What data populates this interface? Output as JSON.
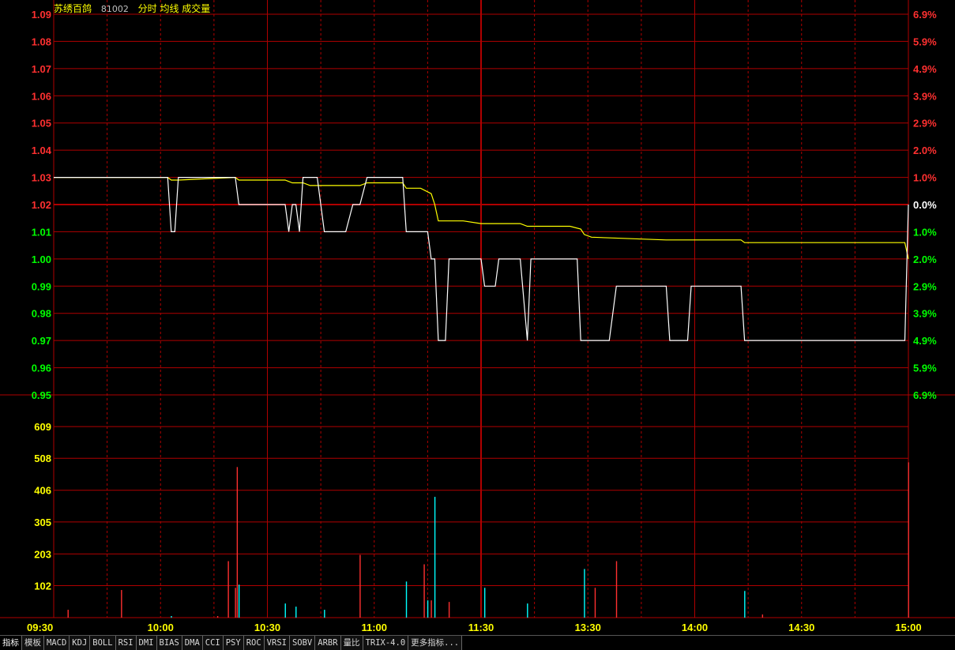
{
  "header": {
    "stock_name": "苏绣百鸽",
    "stock_code": "81002",
    "mode_items": "分时 均线 成交量"
  },
  "tabs": [
    "指标",
    "模板",
    "MACD",
    "KDJ",
    "BOLL",
    "RSI",
    "DMI",
    "BIAS",
    "DMA",
    "CCI",
    "PSY",
    "ROC",
    "VRSI",
    "SOBV",
    "ARBR",
    "量比",
    "TRIX-4.0",
    "更多指标..."
  ],
  "colors": {
    "background": "#000000",
    "grid": "#b00000",
    "price_line": "#ffffff",
    "avg_line": "#ffff00",
    "up": "#ff3030",
    "down": "#00ffff",
    "up_label": "#ff3030",
    "down_label": "#00ff00",
    "volume_label": "#ffff00"
  },
  "chart_data": [
    {
      "type": "line",
      "name": "intraday-price",
      "prev_close": 1.02,
      "ylim": [
        0.95,
        1.09
      ],
      "yticks": [
        "1.09",
        "1.08",
        "1.07",
        "1.06",
        "1.05",
        "1.04",
        "1.03",
        "1.02",
        "1.01",
        "1.00",
        "0.99",
        "0.98",
        "0.97",
        "0.96",
        "0.95"
      ],
      "pct_ticks": [
        "6.9%",
        "5.9%",
        "4.9%",
        "3.9%",
        "2.9%",
        "2.0%",
        "1.0%",
        "0.0%",
        "1.0%",
        "2.0%",
        "2.9%",
        "3.9%",
        "4.9%",
        "5.9%",
        "6.9%"
      ],
      "xticks": [
        "09:30",
        "10:00",
        "10:30",
        "11:00",
        "11:30",
        "13:30",
        "14:00",
        "14:30",
        "15:00"
      ],
      "xlim": [
        0,
        240
      ],
      "price": [
        [
          0,
          1.03
        ],
        [
          32,
          1.03
        ],
        [
          33,
          1.01
        ],
        [
          34,
          1.01
        ],
        [
          35,
          1.03
        ],
        [
          51,
          1.03
        ],
        [
          52,
          1.02
        ],
        [
          65,
          1.02
        ],
        [
          66,
          1.01
        ],
        [
          67,
          1.02
        ],
        [
          68,
          1.02
        ],
        [
          69,
          1.01
        ],
        [
          70,
          1.03
        ],
        [
          74,
          1.03
        ],
        [
          76,
          1.01
        ],
        [
          82,
          1.01
        ],
        [
          84,
          1.02
        ],
        [
          86,
          1.02
        ],
        [
          88,
          1.03
        ],
        [
          98,
          1.03
        ],
        [
          99,
          1.01
        ],
        [
          105,
          1.01
        ],
        [
          106,
          1.0
        ],
        [
          107,
          1.0
        ],
        [
          108,
          0.97
        ],
        [
          110,
          0.97
        ],
        [
          111,
          1.0
        ],
        [
          120,
          1.0
        ],
        [
          121,
          0.99
        ],
        [
          124,
          0.99
        ],
        [
          125,
          1.0
        ],
        [
          131,
          1.0
        ],
        [
          133,
          0.97
        ],
        [
          134,
          1.0
        ],
        [
          147,
          1.0
        ],
        [
          148,
          0.97
        ],
        [
          156,
          0.97
        ],
        [
          158,
          0.99
        ],
        [
          172,
          0.99
        ],
        [
          173,
          0.97
        ],
        [
          178,
          0.97
        ],
        [
          179,
          0.99
        ],
        [
          193,
          0.99
        ],
        [
          194,
          0.97
        ],
        [
          239,
          0.97
        ],
        [
          240,
          1.02
        ]
      ],
      "avg": [
        [
          0,
          1.03
        ],
        [
          32,
          1.03
        ],
        [
          33,
          1.029
        ],
        [
          35,
          1.029
        ],
        [
          51,
          1.03
        ],
        [
          52,
          1.029
        ],
        [
          65,
          1.029
        ],
        [
          67,
          1.028
        ],
        [
          70,
          1.028
        ],
        [
          72,
          1.027
        ],
        [
          76,
          1.027
        ],
        [
          86,
          1.027
        ],
        [
          88,
          1.028
        ],
        [
          98,
          1.028
        ],
        [
          99,
          1.026
        ],
        [
          103,
          1.026
        ],
        [
          106,
          1.024
        ],
        [
          107,
          1.02
        ],
        [
          108,
          1.014
        ],
        [
          115,
          1.014
        ],
        [
          120,
          1.013
        ],
        [
          131,
          1.013
        ],
        [
          133,
          1.012
        ],
        [
          145,
          1.012
        ],
        [
          148,
          1.011
        ],
        [
          149,
          1.009
        ],
        [
          151,
          1.008
        ],
        [
          172,
          1.007
        ],
        [
          193,
          1.007
        ],
        [
          194,
          1.006
        ],
        [
          239,
          1.006
        ],
        [
          240,
          1.0
        ]
      ]
    },
    {
      "type": "bar",
      "name": "volume",
      "ylim": [
        0,
        710
      ],
      "yticks": [
        "609",
        "508",
        "406",
        "305",
        "203",
        "102"
      ],
      "bars": [
        [
          4,
          25,
          "up"
        ],
        [
          19,
          88,
          "up"
        ],
        [
          33,
          5,
          "down"
        ],
        [
          46,
          5,
          "up"
        ],
        [
          49,
          180,
          "up"
        ],
        [
          51,
          95,
          "up"
        ],
        [
          51.5,
          480,
          "up"
        ],
        [
          52,
          105,
          "down"
        ],
        [
          65,
          45,
          "down"
        ],
        [
          68,
          35,
          "down"
        ],
        [
          76,
          25,
          "down"
        ],
        [
          86,
          200,
          "up"
        ],
        [
          99,
          115,
          "down"
        ],
        [
          104,
          170,
          "up"
        ],
        [
          105,
          55,
          "down"
        ],
        [
          106,
          55,
          "up"
        ],
        [
          107,
          385,
          "down"
        ],
        [
          111,
          50,
          "up"
        ],
        [
          121,
          95,
          "down"
        ],
        [
          133,
          45,
          "down"
        ],
        [
          149,
          155,
          "down"
        ],
        [
          152,
          95,
          "up"
        ],
        [
          158,
          180,
          "up"
        ],
        [
          194,
          85,
          "down"
        ],
        [
          199,
          10,
          "up"
        ],
        [
          240,
          495,
          "up"
        ]
      ]
    }
  ]
}
